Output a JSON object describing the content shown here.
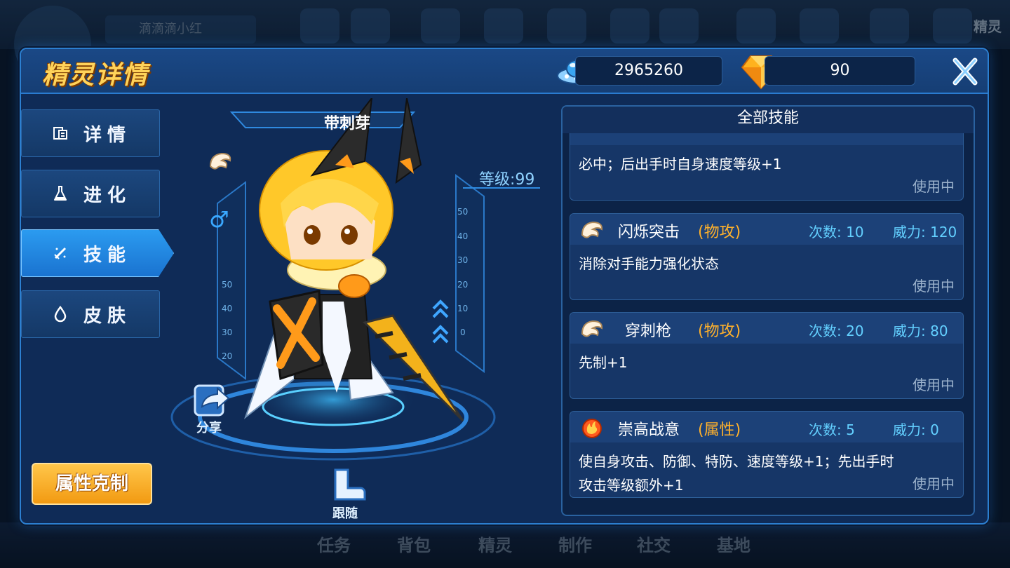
{
  "background": {
    "player_name": "滴滴滴小红",
    "side_label": "精灵",
    "nav": [
      "任务",
      "背包",
      "精灵",
      "制作",
      "社交",
      "基地"
    ]
  },
  "header": {
    "title": "精灵详情",
    "coins": "2965260",
    "gems": "90"
  },
  "tabs": [
    {
      "label": "详情",
      "icon": "card-icon"
    },
    {
      "label": "进化",
      "icon": "flask-icon"
    },
    {
      "label": "技能",
      "icon": "sword-icon",
      "active": true
    },
    {
      "label": "皮肤",
      "icon": "drop-icon"
    }
  ],
  "counter_button": "属性克制",
  "sprite": {
    "name": "带刺芽",
    "level": "等级:99",
    "share_label": "分享",
    "follow_label": "跟随"
  },
  "skills": {
    "title": "全部技能",
    "items": [
      {
        "name": "",
        "category": "",
        "count": "",
        "power": "",
        "desc": "必中；后出手时自身速度等级+1",
        "status": "使用中",
        "icon": "wing-icon",
        "partial": true
      },
      {
        "name": "闪烁突击",
        "category": "(物攻)",
        "count": "次数: 10",
        "power": "威力: 120",
        "desc": "消除对手能力强化状态",
        "status": "使用中",
        "icon": "wing-icon"
      },
      {
        "name": "穿刺枪",
        "category": "(物攻)",
        "count": "次数: 20",
        "power": "威力: 80",
        "desc": "先制+1",
        "status": "使用中",
        "icon": "wing-icon"
      },
      {
        "name": "崇高战意",
        "category": "(属性)",
        "count": "次数: 5",
        "power": "威力: 0",
        "desc": "使自身攻击、防御、特防、速度等级+1；先出手时攻击等级额外+1",
        "status": "使用中",
        "icon": "fire-icon"
      }
    ]
  },
  "colors": {
    "accent": "#2c7fd0",
    "title": "#ffd35a",
    "category": "#ffb12b",
    "stat": "#63d0ff",
    "button": "#f29a12"
  }
}
